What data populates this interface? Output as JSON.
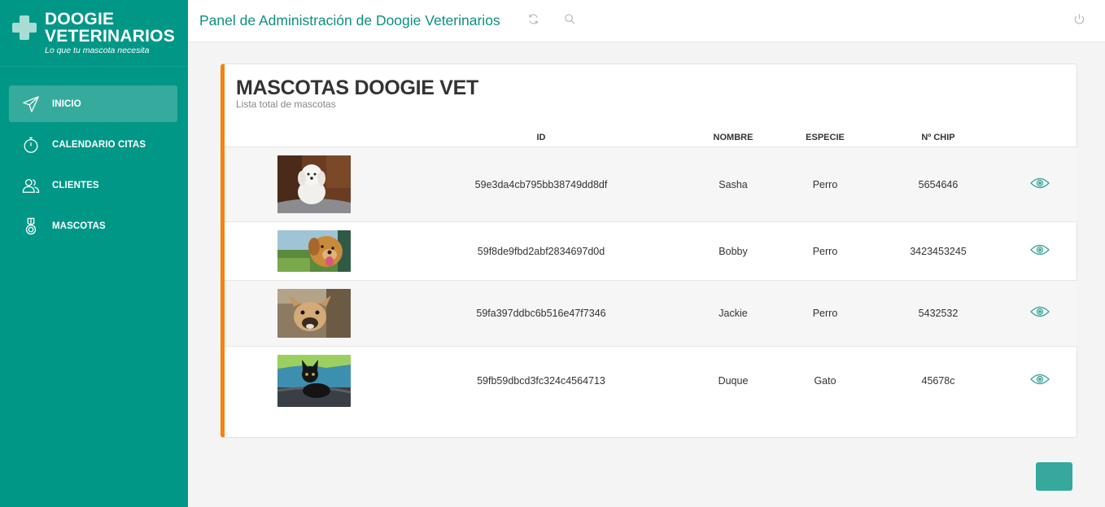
{
  "brand": {
    "name_line1": "DOOGIE",
    "name_line2": "VETERINARIOS",
    "tagline": "Lo que tu mascota necesita",
    "primary_color": "#009787",
    "accent_color": "#f5830f"
  },
  "sidebar": {
    "items": [
      {
        "label": "INICIO",
        "icon": "send-icon",
        "active": true
      },
      {
        "label": "CALENDARIO CITAS",
        "icon": "stopwatch-icon",
        "active": false
      },
      {
        "label": "CLIENTES",
        "icon": "users-icon",
        "active": false
      },
      {
        "label": "MASCOTAS",
        "icon": "medal-icon",
        "active": false
      }
    ]
  },
  "header": {
    "title": "Panel de Administración de Doogie Veterinarios",
    "icons": [
      "refresh-icon",
      "search-icon",
      "power-icon"
    ]
  },
  "card": {
    "title": "MASCOTAS DOOGIE VET",
    "subtitle": "Lista total de mascotas"
  },
  "table": {
    "columns": [
      "ID",
      "NOMBRE",
      "ESPECIE",
      "Nº CHIP"
    ],
    "rows": [
      {
        "photo": "white-puppy-photo",
        "id": "59e3da4cb795bb38749dd8df",
        "nombre": "Sasha",
        "especie": "Perro",
        "chip": "5654646"
      },
      {
        "photo": "golden-dog-photo",
        "id": "59f8de9fbd2abf2834697d0d",
        "nombre": "Bobby",
        "especie": "Perro",
        "chip": "3423453245"
      },
      {
        "photo": "small-dog-photo",
        "id": "59fa397ddbc6b516e47f7346",
        "nombre": "Jackie",
        "especie": "Perro",
        "chip": "5432532"
      },
      {
        "photo": "black-kitten-photo",
        "id": "59fb59dbcd3fc324c4564713",
        "nombre": "Duque",
        "especie": "Gato",
        "chip": "45678c"
      }
    ]
  }
}
